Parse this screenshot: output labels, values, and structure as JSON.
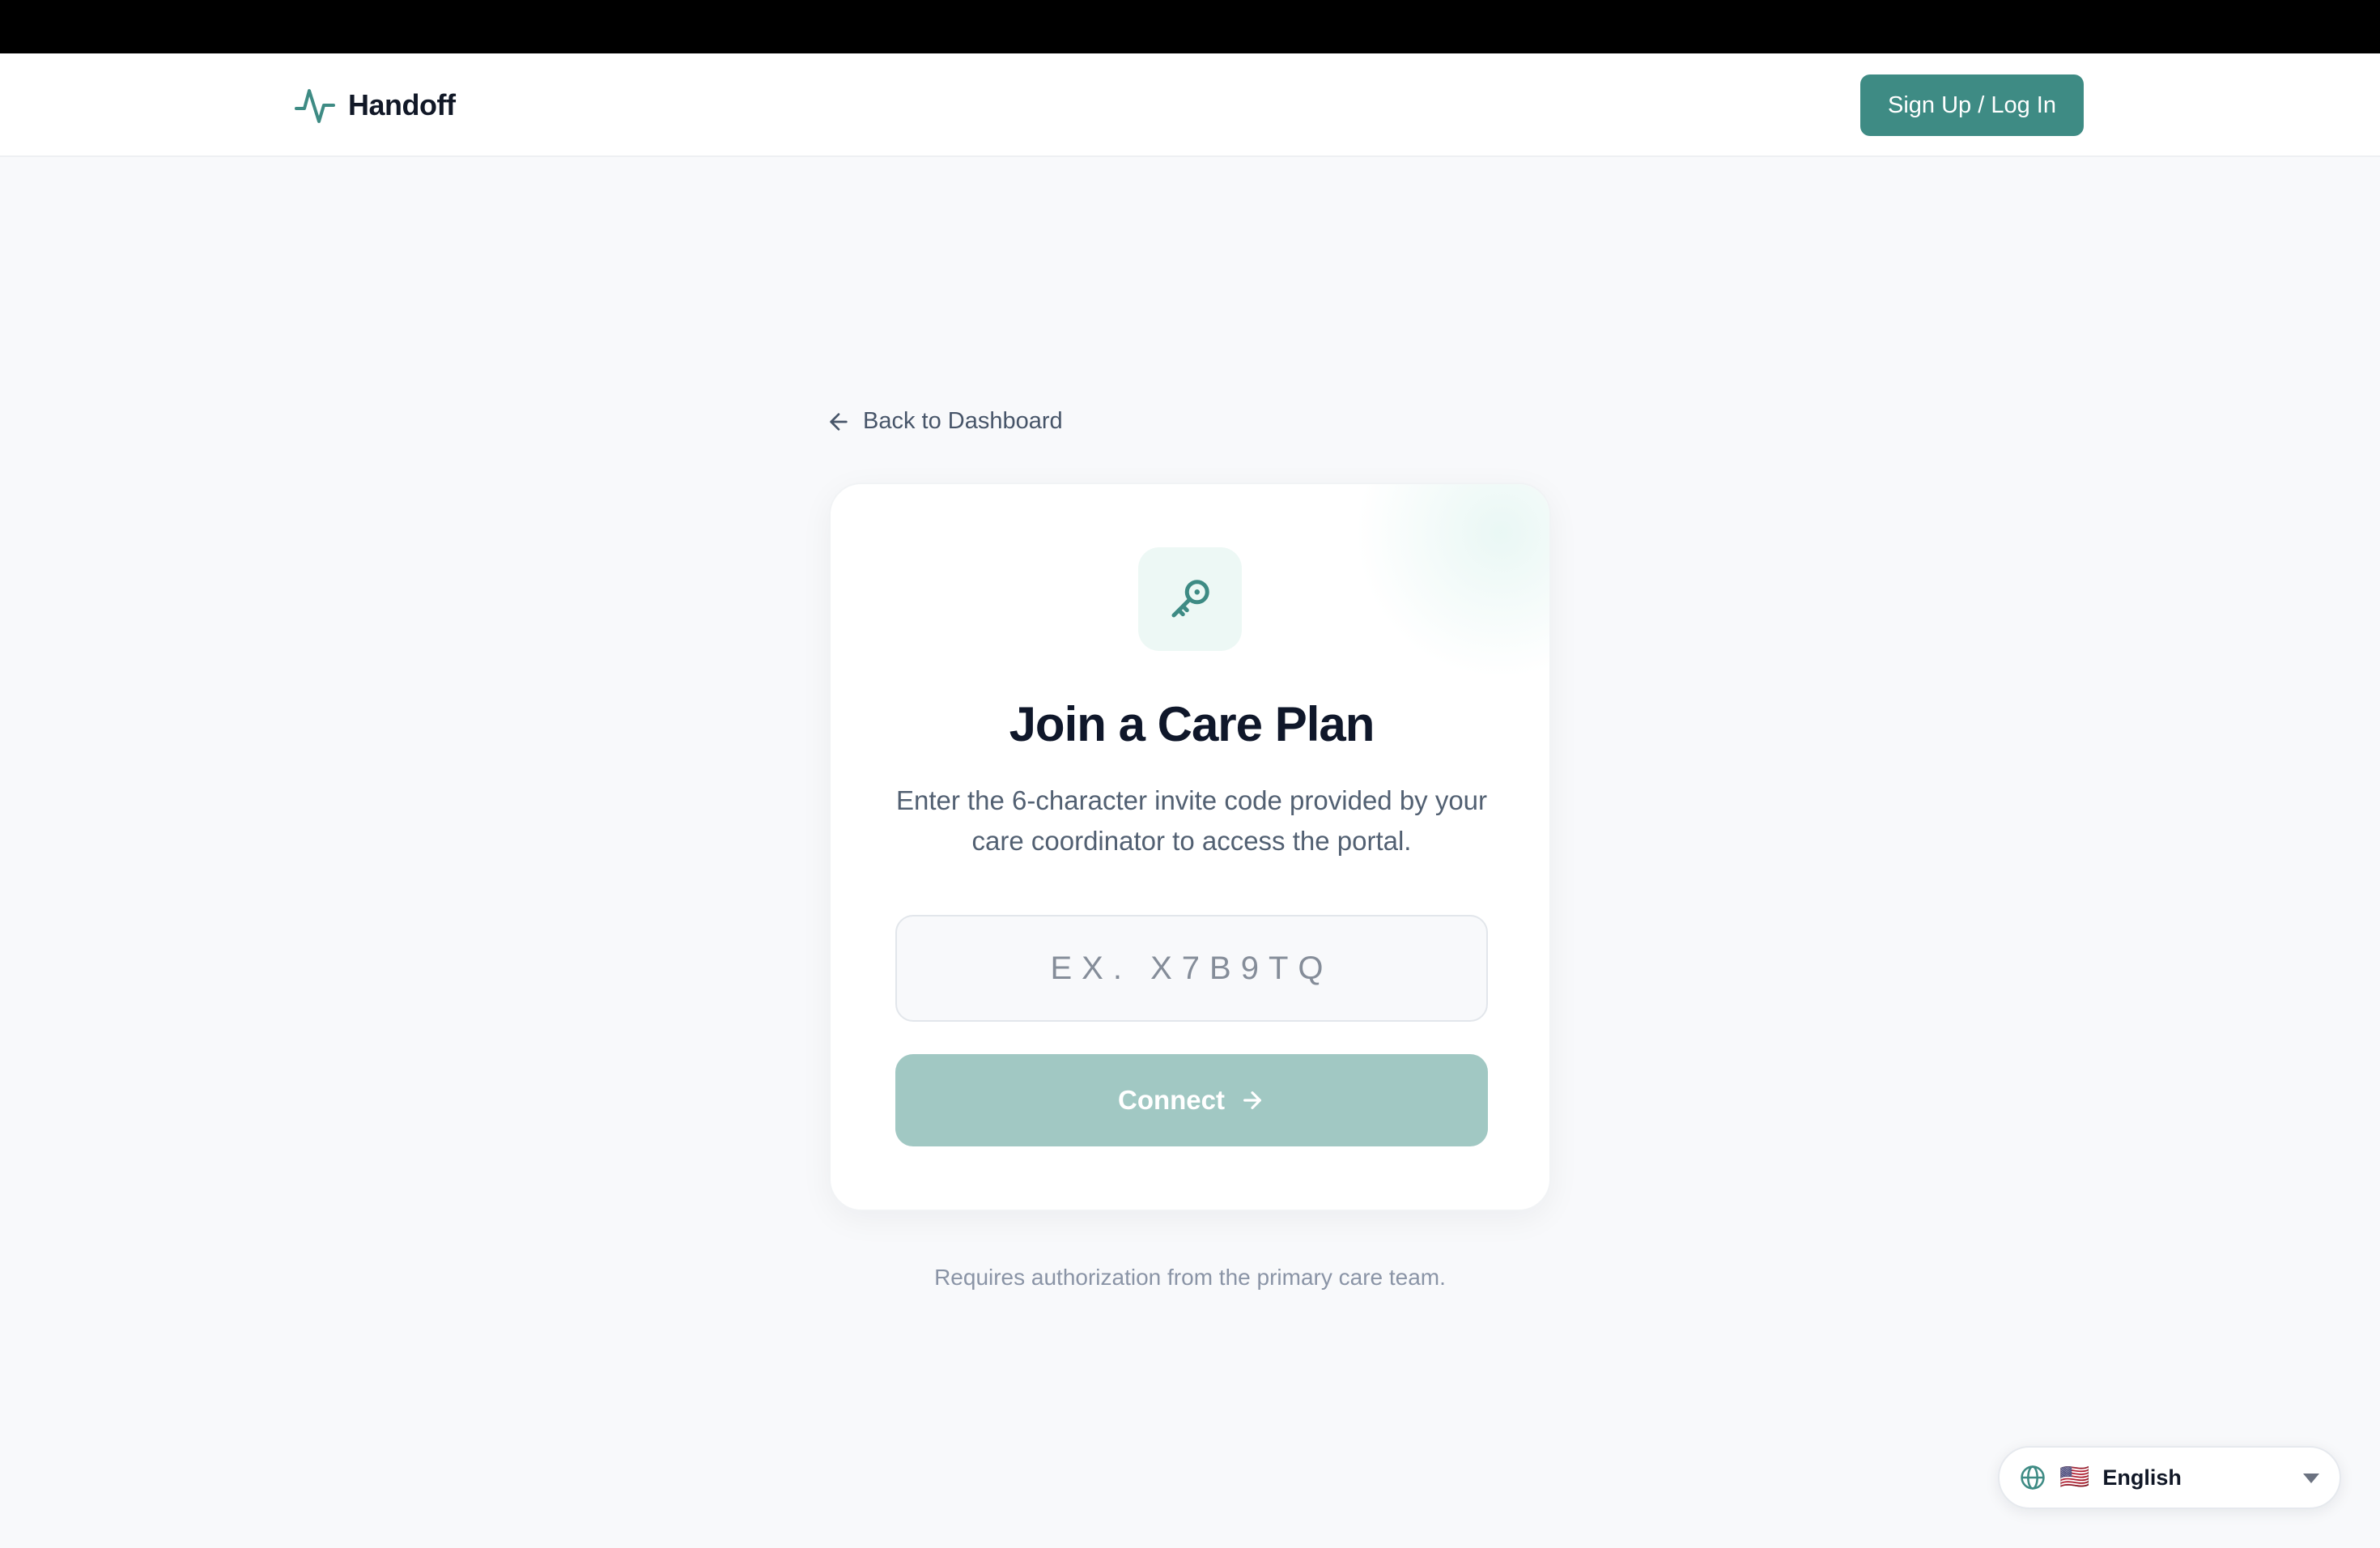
{
  "app": {
    "brand_name": "Handoff",
    "signup_label": "Sign Up / Log In"
  },
  "nav": {
    "back_label": "Back to Dashboard"
  },
  "card": {
    "title": "Join a Care Plan",
    "description": "Enter the 6-character invite code provided by your care coordinator to access the portal.",
    "input_placeholder": "EX. X7B9TQ",
    "input_value": "",
    "connect_label": "Connect"
  },
  "footnote": "Requires authorization from the primary care team.",
  "language": {
    "flag": "🇺🇸",
    "selected": "English"
  },
  "icons": {
    "brand": "pulse-icon",
    "back": "arrow-left-icon",
    "card": "key-icon",
    "connect": "arrow-right-icon",
    "language": "globe-icon",
    "dropdown": "caret-down-icon"
  },
  "colors": {
    "brand_teal": "#3e8b84",
    "connect_disabled": "#a1c8c3",
    "key_badge_bg": "#edf8f5",
    "page_bg": "#f8f9fb",
    "title_text": "#0f172a"
  }
}
